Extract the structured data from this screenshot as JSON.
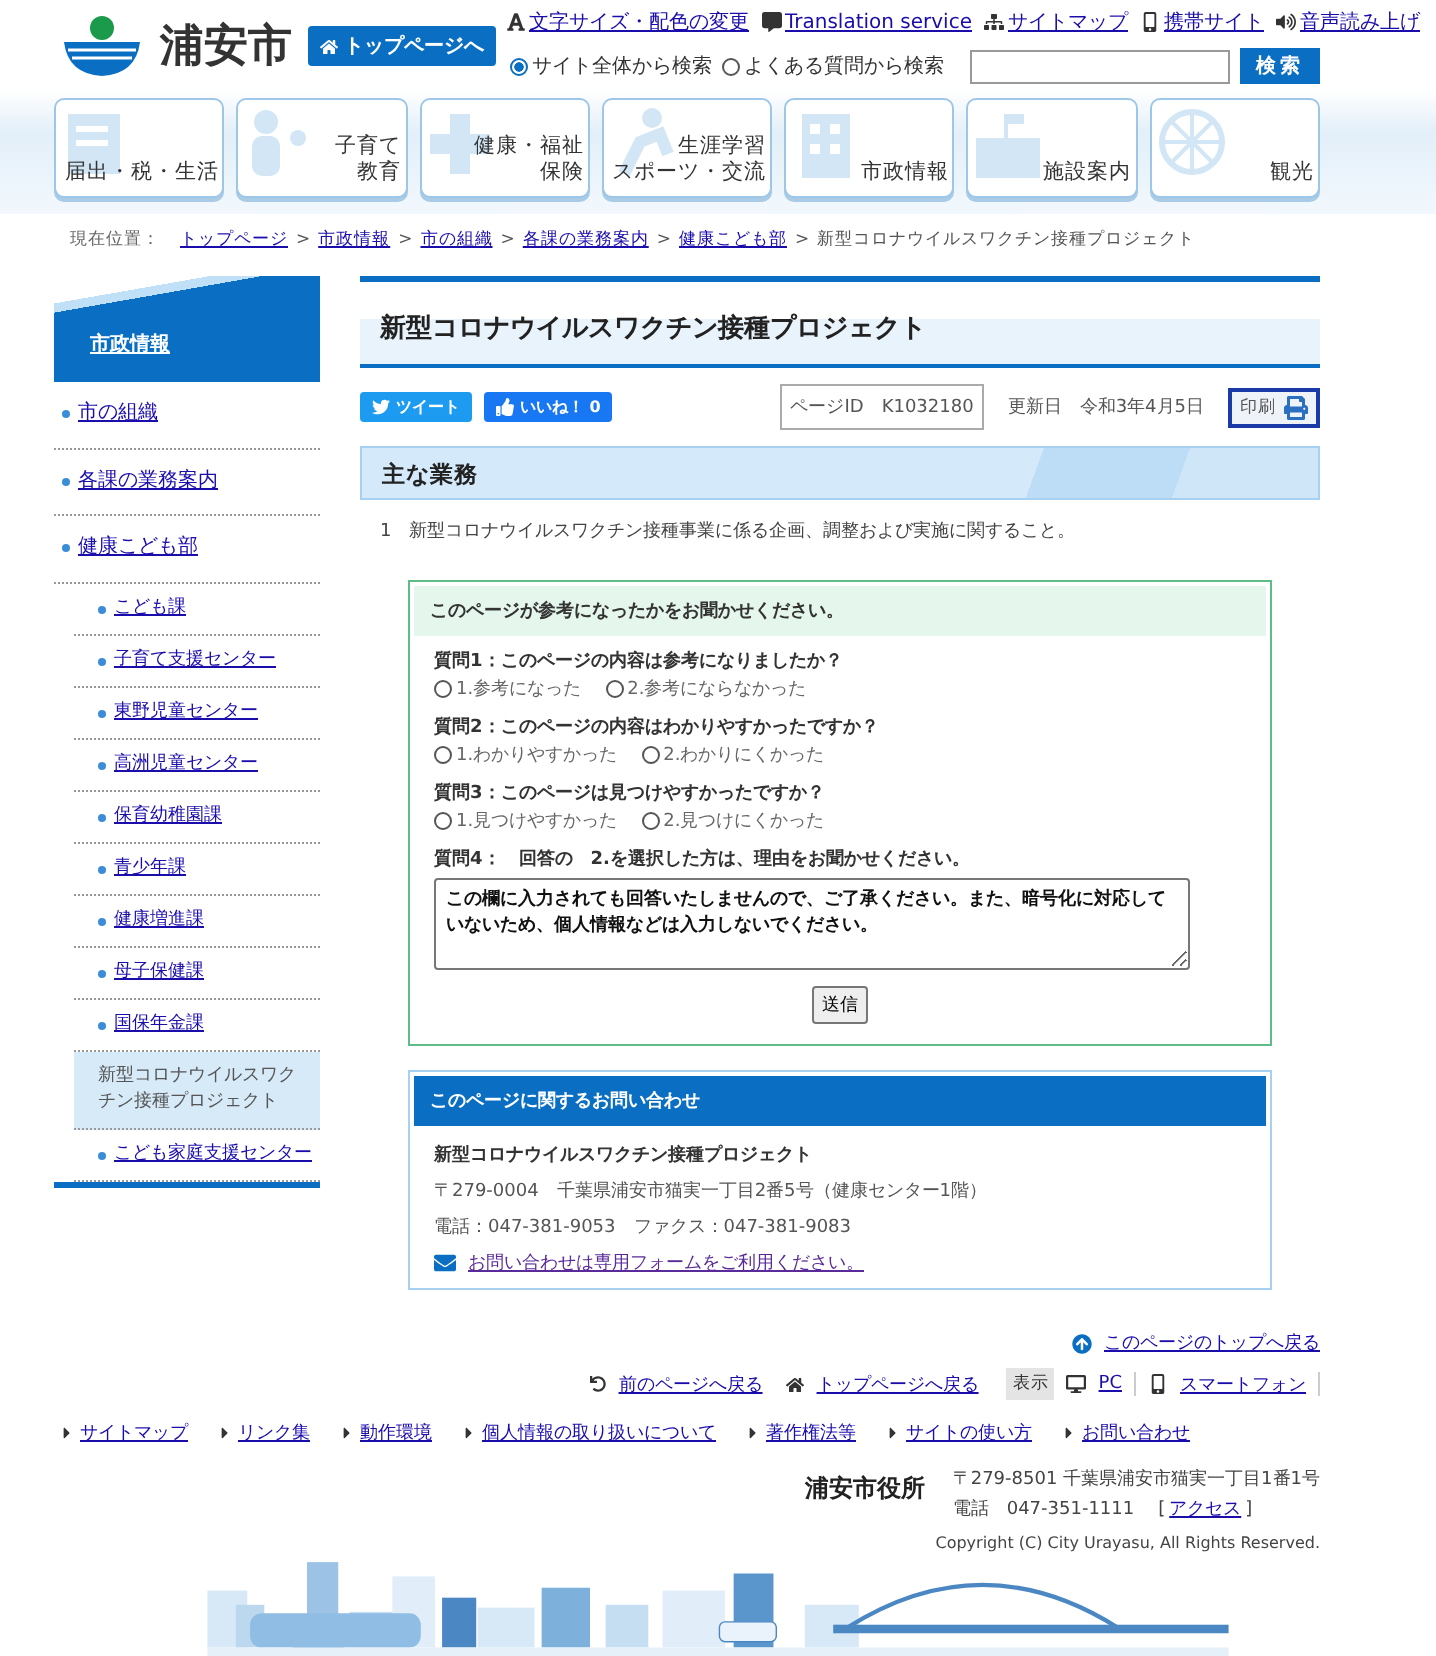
{
  "header": {
    "city_name": "浦安市",
    "top_page_button": "トップページへ",
    "utility_links": [
      "文字サイズ・配色の変更",
      "Translation service",
      "サイトマップ",
      "携帯サイト",
      "音声読み上げ"
    ],
    "search": {
      "options": [
        {
          "label": "サイト全体から検索",
          "selected": true
        },
        {
          "label": "よくある質問から検索",
          "selected": false
        }
      ],
      "button": "検索"
    }
  },
  "nav": [
    {
      "lines": [
        "届出・税・生活"
      ]
    },
    {
      "lines": [
        "子育て",
        "教育"
      ]
    },
    {
      "lines": [
        "健康・福祉",
        "保険"
      ]
    },
    {
      "lines": [
        "生涯学習",
        "スポーツ・交流"
      ]
    },
    {
      "lines": [
        "市政情報"
      ]
    },
    {
      "lines": [
        "施設案内"
      ]
    },
    {
      "lines": [
        "観光"
      ]
    }
  ],
  "breadcrumb": {
    "label": "現在位置：",
    "separator": ">",
    "links": [
      "トップページ",
      "市政情報",
      "市の組織",
      "各課の業務案内",
      "健康こども部"
    ],
    "current": "新型コロナウイルスワクチン接種プロジェクト"
  },
  "sidebar": {
    "title": "市政情報",
    "items": [
      {
        "label": "市の組織",
        "selected": false
      },
      {
        "label": "各課の業務案内",
        "selected": false
      },
      {
        "label": "健康こども部",
        "selected": false,
        "children": [
          {
            "label": "こども課",
            "selected": false
          },
          {
            "label": "子育て支援センター",
            "selected": false
          },
          {
            "label": "東野児童センター",
            "selected": false
          },
          {
            "label": "高洲児童センター",
            "selected": false
          },
          {
            "label": "保育幼稚園課",
            "selected": false
          },
          {
            "label": "青少年課",
            "selected": false
          },
          {
            "label": "健康増進課",
            "selected": false
          },
          {
            "label": "母子保健課",
            "selected": false
          },
          {
            "label": "国保年金課",
            "selected": false
          },
          {
            "label": "新型コロナウイルスワクチン接種プロジェクト",
            "selected": true
          },
          {
            "label": "こども家庭支援センター",
            "selected": false
          }
        ]
      }
    ]
  },
  "main": {
    "title": "新型コロナウイルスワクチン接種プロジェクト",
    "share": {
      "tweet": "ツイート",
      "like": "いいね！ 0"
    },
    "page_id": {
      "label": "ページID",
      "value": "K1032180"
    },
    "updated": {
      "label": "更新日",
      "value": "令和3年4月5日"
    },
    "print": "印刷",
    "section_heading": "主な業務",
    "duties": [
      {
        "number": "1",
        "text": "新型コロナウイルスワクチン接種事業に係る企画、調整および実施に関すること。"
      }
    ],
    "survey": {
      "title": "このページが参考になったかをお聞かせください。",
      "questions": [
        {
          "label": "質問1：このページの内容は参考になりましたか？",
          "options": [
            {
              "label": "1.参考になった",
              "selected": false
            },
            {
              "label": "2.参考にならなかった",
              "selected": false
            }
          ]
        },
        {
          "label": "質問2：このページの内容はわかりやすかったですか？",
          "options": [
            {
              "label": "1.わかりやすかった",
              "selected": false
            },
            {
              "label": "2.わかりにくかった",
              "selected": false
            }
          ]
        },
        {
          "label": "質問3：このページは見つけやすかったですか？",
          "options": [
            {
              "label": "1.見つけやすかった",
              "selected": false
            },
            {
              "label": "2.見つけにくかった",
              "selected": false
            }
          ]
        }
      ],
      "comment_label": "質問4：　回答の　2.を選択した方は、理由をお聞かせください。",
      "comment_value": "この欄に入力されても回答いたしませんので、ご了承ください。また、暗号化に対応していないため、個人情報などは入力しないでください。",
      "submit": "送信"
    },
    "contact": {
      "heading": "このページに関するお問い合わせ",
      "department": "新型コロナウイルスワクチン接種プロジェクト",
      "address": "〒279-0004　千葉県浦安市猫実一丁目2番5号（健康センター1階）",
      "phone": "電話：047-381-9053　ファクス：047-381-9083",
      "form_link": "お問い合わせは専用フォームをご利用ください。"
    }
  },
  "footer": {
    "page_top": "このページのトップへ戻る",
    "back": "前のページへ戻る",
    "top": "トップページへ戻る",
    "display_label": "表示",
    "pc": "PC",
    "smartphone": "スマートフォン",
    "links": [
      "サイトマップ",
      "リンク集",
      "動作環境",
      "個人情報の取り扱いについて",
      "著作権法等",
      "サイトの使い方",
      "お問い合わせ"
    ],
    "office": {
      "name": "浦安市役所",
      "address": "〒279-8501 千葉県浦安市猫実一丁目1番1号",
      "phone": "電話　047-351-1111",
      "bracket_open": "[",
      "access": "アクセス",
      "bracket_close": "]"
    },
    "copyright": "Copyright (C) City Urayasu, All Rights Reserved."
  }
}
